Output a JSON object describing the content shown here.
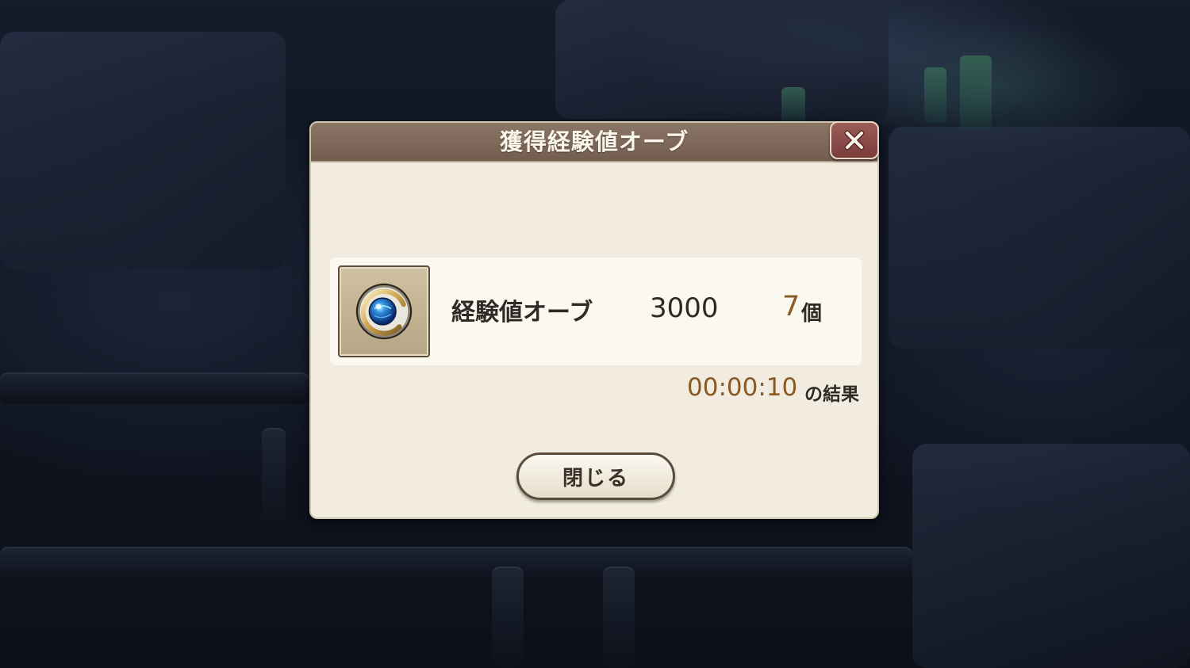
{
  "dialog": {
    "title": "獲得経験値オーブ",
    "close_icon": "close-x-icon"
  },
  "reward": {
    "icon": "experience-orb-icon",
    "name": "経験値オーブ",
    "value": "3000",
    "count": "7",
    "unit": "個"
  },
  "result": {
    "time": "00:00:10",
    "suffix": "の結果"
  },
  "footer": {
    "close_label": "閉じる"
  },
  "colors": {
    "header": "#7d6759",
    "panel": "#f1ecdf",
    "accent_brown": "#8a5a24",
    "close_red": "#8a4a46"
  }
}
